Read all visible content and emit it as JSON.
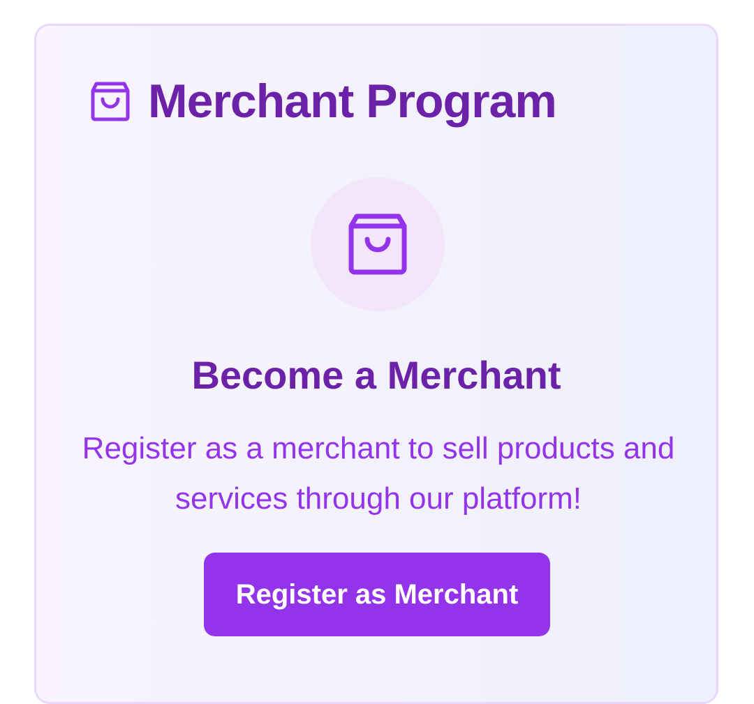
{
  "header": {
    "icon": "shopping-bag-icon",
    "title": "Merchant Program"
  },
  "hero": {
    "icon": "shopping-bag-icon",
    "subtitle": "Become a Merchant",
    "description": "Register as a merchant to sell products and services through our platform!"
  },
  "cta": {
    "label": "Register as Merchant"
  },
  "colors": {
    "title": "#6b21a8",
    "accent": "#9333ea",
    "icon_circle_bg": "#f3e6fb",
    "card_border": "#ead7fb"
  }
}
